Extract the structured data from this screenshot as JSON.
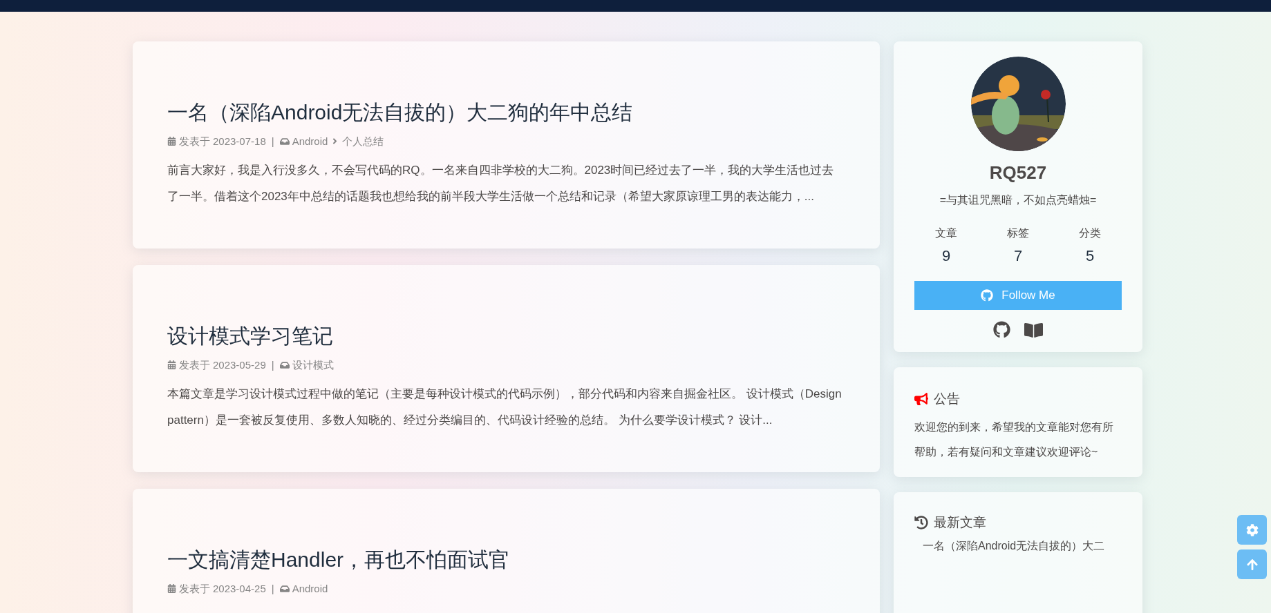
{
  "meta_separator": "|",
  "posts": [
    {
      "title": "一名（深陷Android无法自拔的）大二狗的年中总结",
      "date_label": "发表于",
      "date": "2023-07-18",
      "categories": [
        "Android",
        "个人总结"
      ],
      "excerpt": "前言大家好，我是入行没多久，不会写代码的RQ。一名来自四非学校的大二狗。2023时间已经过去了一半，我的大学生活也过去了一半。借着这个2023年中总结的话题我也想给我的前半段大学生活做一个总结和记录（希望大家原谅理工男的表达能力，..."
    },
    {
      "title": "设计模式学习笔记",
      "date_label": "发表于",
      "date": "2023-05-29",
      "categories": [
        "设计模式"
      ],
      "excerpt": "本篇文章是学习设计模式过程中做的笔记（主要是每种设计模式的代码示例），部分代码和内容来自掘金社区。 设计模式（Design pattern）是一套被反复使用、多数人知晓的、经过分类编目的、代码设计经验的总结。 为什么要学设计模式？ 设计..."
    },
    {
      "title": "一文搞清楚Handler，再也不怕面试官",
      "date_label": "发表于",
      "date": "2023-04-25",
      "categories": [
        "Android"
      ]
    }
  ],
  "profile": {
    "name": "RQ527",
    "motto": "=与其诅咒黑暗，不如点亮蜡烛=",
    "stats": [
      {
        "label": "文章",
        "value": "9"
      },
      {
        "label": "标签",
        "value": "7"
      },
      {
        "label": "分类",
        "value": "5"
      }
    ],
    "follow_button": "Follow Me"
  },
  "announcement": {
    "title": "公告",
    "text": "欢迎您的到来，希望我的文章能对您有所帮助，若有疑问和文章建议欢迎评论~"
  },
  "recent": {
    "title": "最新文章",
    "items": [
      "一名（深陷Android无法自拔的）大二"
    ]
  }
}
